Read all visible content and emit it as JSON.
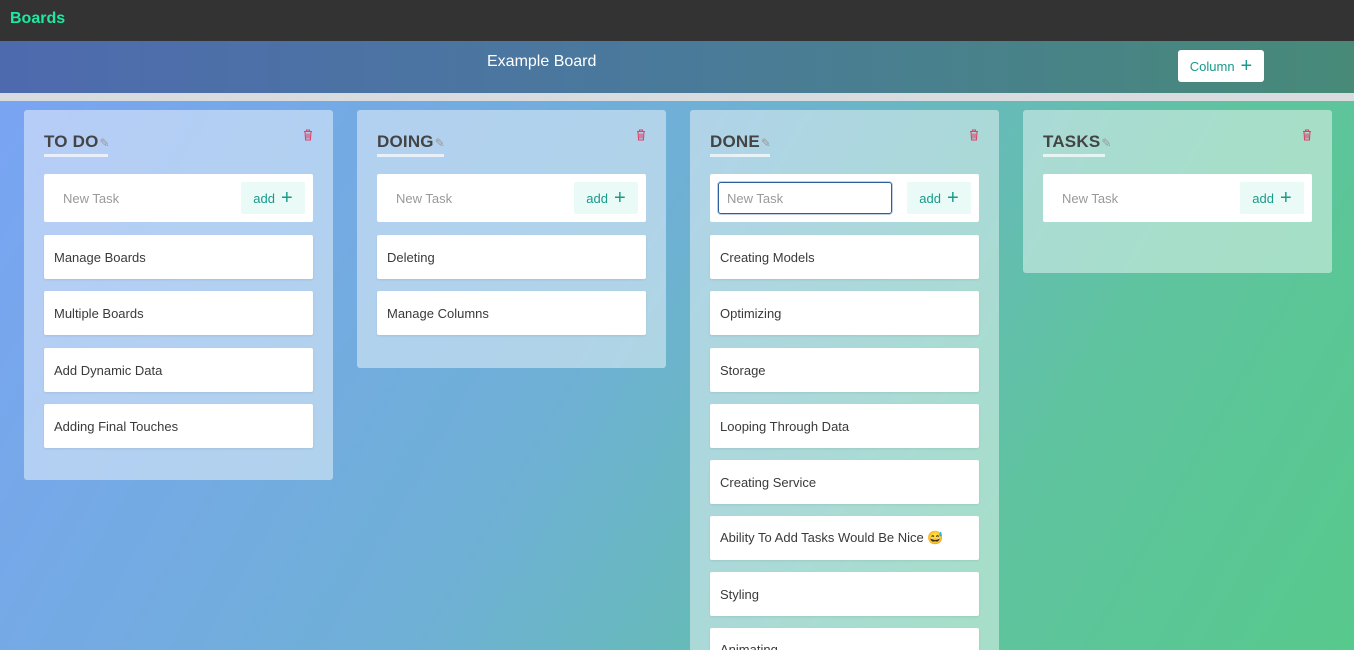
{
  "navbar": {
    "brand": "Boards"
  },
  "board": {
    "title": "Example Board",
    "column_button": "Column"
  },
  "columns": [
    {
      "title": "TO DO",
      "input_placeholder": "New Task",
      "add_label": "add",
      "tasks": [
        "Manage Boards",
        "Multiple Boards",
        "Add Dynamic Data",
        "Adding Final Touches"
      ]
    },
    {
      "title": "DOING",
      "input_placeholder": "New Task",
      "add_label": "add",
      "tasks": [
        "Deleting",
        "Manage Columns"
      ]
    },
    {
      "title": "DONE",
      "input_placeholder": "New Task",
      "add_label": "add",
      "tasks": [
        "Creating Models",
        "Optimizing",
        "Storage",
        "Looping Through Data",
        "Creating Service",
        "Ability To Add Tasks Would Be Nice 😅",
        "Styling",
        "Animating"
      ]
    },
    {
      "title": "TASKS",
      "input_placeholder": "New Task",
      "add_label": "add",
      "tasks": []
    }
  ],
  "colors": {
    "brand": "#1de9a0",
    "accent": "#1a9a8a",
    "delete": "#e0406a"
  },
  "icons": {
    "edit": "pencil-icon",
    "delete": "trash-icon",
    "add": "plus-icon"
  }
}
